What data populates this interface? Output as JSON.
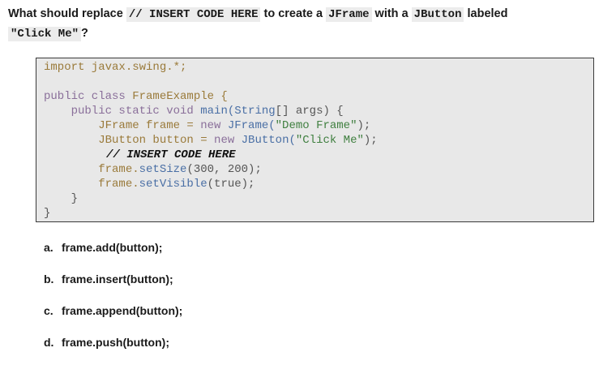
{
  "question": {
    "prefix": "What should replace",
    "chip1": "// INSERT CODE HERE",
    "mid1": "to create a",
    "chip2": "JFrame",
    "mid2": "with a",
    "chip3": "JButton",
    "suffix1": "labeled",
    "chip4": "\"Click Me\"",
    "suffix2": "?"
  },
  "code": {
    "l1": "import javax.swing.*;",
    "l2a": "public class ",
    "l2b": "FrameExample {",
    "l3a": "    public static void ",
    "l3b": "main(",
    "l3c": "String",
    "l3d": "[] args) {",
    "l4a": "        JFrame frame = ",
    "l4b": "new ",
    "l4c": "JFrame(",
    "l4d": "\"Demo Frame\"",
    "l4e": ");",
    "l5a": "        JButton button = ",
    "l5b": "new ",
    "l5c": "JButton(",
    "l5d": "\"Click Me\"",
    "l5e": ");",
    "l6": "// INSERT CODE HERE",
    "l7a": "        frame.",
    "l7b": "setSize",
    "l7c": "(300, 200);",
    "l8a": "        frame.",
    "l8b": "setVisible",
    "l8c": "(true);",
    "l9": "    }",
    "l10": "}"
  },
  "options": [
    {
      "letter": "a.",
      "text": "frame.add(button);"
    },
    {
      "letter": "b.",
      "text": "frame.insert(button);"
    },
    {
      "letter": "c.",
      "text": "frame.append(button);"
    },
    {
      "letter": "d.",
      "text": "frame.push(button);"
    }
  ]
}
